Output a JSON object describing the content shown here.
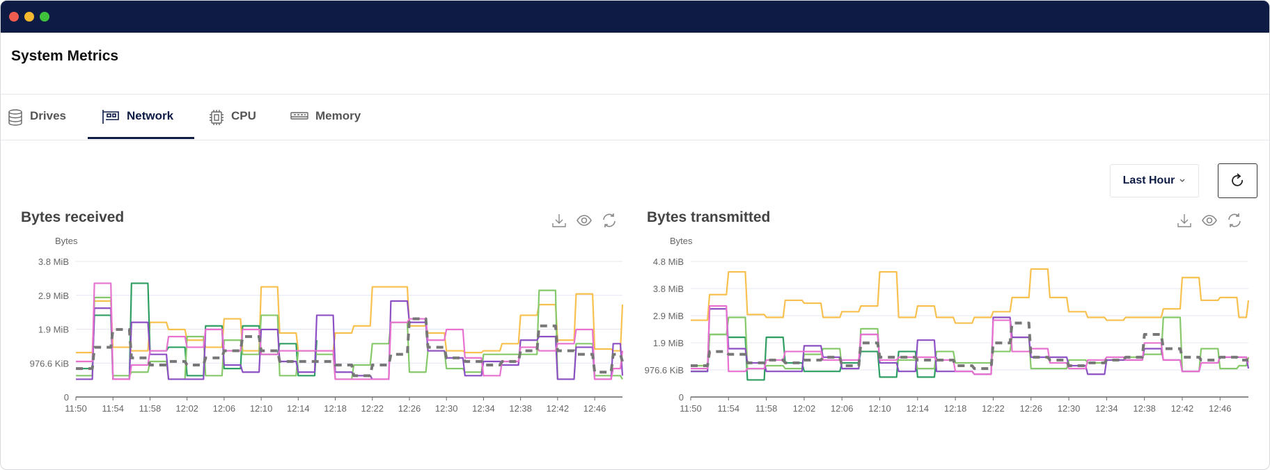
{
  "window": {
    "controls": {
      "close_color": "#ee5d50",
      "minimize_color": "#f5b82e",
      "maximize_color": "#3fc33d"
    }
  },
  "header": {
    "title": "System Metrics"
  },
  "tabs": [
    {
      "label": "Drives",
      "icon": "database-icon",
      "active": false
    },
    {
      "label": "Network",
      "icon": "network-card-icon",
      "active": true
    },
    {
      "label": "CPU",
      "icon": "cpu-chip-icon",
      "active": false
    },
    {
      "label": "Memory",
      "icon": "memory-module-icon",
      "active": false
    }
  ],
  "toolbar": {
    "time_range": "Last Hour",
    "refresh_icon": "refresh-icon"
  },
  "colors": {
    "yellow": "#f8c04e",
    "dark_green": "#2f9e62",
    "light_green": "#86c96b",
    "purple": "#8d4fc4",
    "pink": "#e772cf",
    "average": "#777777",
    "accent": "#0d1b45"
  },
  "chart_data": [
    {
      "type": "line",
      "title": "Bytes received",
      "ylabel": "Bytes",
      "x": [
        "11:50",
        "11:52",
        "11:54",
        "11:56",
        "11:58",
        "12:00",
        "12:02",
        "12:04",
        "12:06",
        "12:08",
        "12:10",
        "12:12",
        "12:14",
        "12:16",
        "12:18",
        "12:20",
        "12:22",
        "12:24",
        "12:26",
        "12:28",
        "12:30",
        "12:32",
        "12:34",
        "12:36",
        "12:38",
        "12:40",
        "12:42",
        "12:44",
        "12:46",
        "12:48",
        "12:49"
      ],
      "x_ticks": [
        "11:50",
        "11:54",
        "11:58",
        "12:02",
        "12:06",
        "12:10",
        "12:14",
        "12:18",
        "12:22",
        "12:26",
        "12:30",
        "12:34",
        "12:38",
        "12:42",
        "12:46"
      ],
      "y_unit": "MiB",
      "y_ticks": [
        {
          "value": 0,
          "label": "0"
        },
        {
          "value": 0.9537,
          "label": "976.6 KiB"
        },
        {
          "value": 1.907,
          "label": "1.9 MiB"
        },
        {
          "value": 2.861,
          "label": "2.9 MiB"
        },
        {
          "value": 3.815,
          "label": "3.8 MiB"
        }
      ],
      "ylim": [
        0,
        3.815
      ],
      "grid": true,
      "series": [
        {
          "color": "#f8c04e",
          "values": [
            1.25,
            2.7,
            1.4,
            1.3,
            2.1,
            1.9,
            1.6,
            1.4,
            2.2,
            1.3,
            3.1,
            1.8,
            1.3,
            1.3,
            1.8,
            2.0,
            3.1,
            3.1,
            2.0,
            1.8,
            1.3,
            1.25,
            1.3,
            1.5,
            2.3,
            2.6,
            1.6,
            2.9,
            1.35,
            1.3,
            2.6
          ]
        },
        {
          "color": "#2f9e62",
          "values": [
            0.8,
            2.3,
            0.5,
            3.2,
            1.3,
            1.4,
            0.6,
            2.0,
            0.8,
            2.0,
            1.2,
            1.5,
            0.6,
            1.6,
            null,
            null,
            null,
            null,
            null,
            null,
            null,
            null,
            null,
            null,
            null,
            null,
            null,
            null,
            null,
            null,
            null
          ]
        },
        {
          "color": "#86c96b",
          "values": [
            0.6,
            2.8,
            0.6,
            0.7,
            1.0,
            0.5,
            1.7,
            0.6,
            1.6,
            1.2,
            2.3,
            0.6,
            1.3,
            1.2,
            0.5,
            0.9,
            1.5,
            2.1,
            0.7,
            1.3,
            0.8,
            0.7,
            1.2,
            1.2,
            1.2,
            3.0,
            0.5,
            1.5,
            0.6,
            0.6,
            0.5
          ]
        },
        {
          "color": "#8d4fc4",
          "values": [
            0.5,
            2.5,
            0.5,
            2.1,
            1.2,
            0.5,
            0.5,
            1.9,
            0.9,
            0.7,
            1.9,
            1.0,
            0.7,
            2.3,
            0.7,
            0.6,
            0.5,
            2.7,
            2.1,
            1.3,
            1.1,
            0.6,
            1.0,
            0.9,
            1.6,
            1.7,
            0.5,
            1.4,
            0.5,
            1.5,
            0.6
          ]
        },
        {
          "color": "#e772cf",
          "values": [
            1.0,
            3.2,
            0.5,
            0.9,
            1.3,
            1.7,
            1.4,
            1.9,
            1.3,
            1.9,
            1.2,
            1.3,
            1.3,
            1.3,
            0.5,
            0.5,
            0.5,
            2.1,
            2.2,
            1.6,
            1.9,
            1.1,
            0.6,
            1.0,
            1.4,
            1.3,
            1.5,
            1.9,
            0.5,
            0.8,
            1.3
          ]
        },
        {
          "color": "#777777",
          "dashed": true,
          "values": [
            0.8,
            1.4,
            1.9,
            1.1,
            0.9,
            1.0,
            0.9,
            1.1,
            1.3,
            1.7,
            1.3,
            1.0,
            1.0,
            1.0,
            0.9,
            0.6,
            0.9,
            1.2,
            2.2,
            1.4,
            1.1,
            1.0,
            0.9,
            1.0,
            1.3,
            2.0,
            1.3,
            1.2,
            0.7,
            1.2,
            1.0
          ]
        }
      ]
    },
    {
      "type": "line",
      "title": "Bytes transmitted",
      "ylabel": "Bytes",
      "x": [
        "11:50",
        "11:52",
        "11:54",
        "11:56",
        "11:58",
        "12:00",
        "12:02",
        "12:04",
        "12:06",
        "12:08",
        "12:10",
        "12:12",
        "12:14",
        "12:16",
        "12:18",
        "12:20",
        "12:22",
        "12:24",
        "12:26",
        "12:28",
        "12:30",
        "12:32",
        "12:34",
        "12:36",
        "12:38",
        "12:40",
        "12:42",
        "12:44",
        "12:46",
        "12:48",
        "12:49"
      ],
      "x_ticks": [
        "11:50",
        "11:54",
        "11:58",
        "12:02",
        "12:06",
        "12:10",
        "12:14",
        "12:18",
        "12:22",
        "12:26",
        "12:30",
        "12:34",
        "12:38",
        "12:42",
        "12:46"
      ],
      "y_unit": "MiB",
      "y_ticks": [
        {
          "value": 0,
          "label": "0"
        },
        {
          "value": 0.9537,
          "label": "976.6 KiB"
        },
        {
          "value": 1.907,
          "label": "1.9 MiB"
        },
        {
          "value": 2.861,
          "label": "2.9 MiB"
        },
        {
          "value": 3.815,
          "label": "3.8 MiB"
        },
        {
          "value": 4.768,
          "label": "4.8 MiB"
        }
      ],
      "ylim": [
        0,
        4.768
      ],
      "grid": true,
      "series": [
        {
          "color": "#f8c04e",
          "values": [
            2.7,
            3.6,
            4.4,
            2.9,
            2.8,
            3.4,
            3.3,
            2.8,
            3.0,
            3.2,
            4.4,
            2.8,
            3.2,
            2.8,
            2.6,
            2.8,
            3.0,
            3.5,
            4.5,
            3.5,
            3.0,
            2.8,
            2.7,
            2.8,
            2.8,
            3.1,
            4.2,
            3.4,
            3.5,
            2.8,
            3.4
          ]
        },
        {
          "color": "#2f9e62",
          "values": [
            0.9,
            2.2,
            2.1,
            0.6,
            2.1,
            1.2,
            0.9,
            0.9,
            1.2,
            1.6,
            0.7,
            1.6,
            0.7,
            1.4,
            null,
            null,
            null,
            null,
            null,
            null,
            null,
            null,
            null,
            null,
            null,
            null,
            null,
            null,
            null,
            null,
            null
          ]
        },
        {
          "color": "#86c96b",
          "values": [
            1.1,
            2.2,
            2.8,
            1.0,
            1.1,
            1.0,
            1.5,
            1.7,
            1.0,
            2.4,
            1.2,
            1.3,
            1.0,
            1.6,
            1.2,
            1.2,
            1.6,
            2.1,
            1.0,
            1.0,
            1.3,
            1.2,
            1.3,
            1.4,
            1.5,
            2.8,
            0.9,
            1.7,
            1.0,
            1.1,
            1.4
          ]
        },
        {
          "color": "#8d4fc4",
          "values": [
            0.9,
            3.1,
            1.7,
            1.2,
            0.9,
            0.9,
            1.8,
            1.4,
            1.0,
            2.2,
            1.2,
            0.9,
            2.0,
            0.9,
            0.9,
            0.8,
            2.8,
            2.1,
            1.4,
            1.4,
            1.1,
            0.8,
            1.3,
            1.3,
            1.7,
            1.3,
            0.9,
            1.2,
            1.4,
            1.4,
            1.0
          ]
        },
        {
          "color": "#e772cf",
          "values": [
            1.0,
            3.2,
            0.9,
            1.0,
            1.3,
            1.6,
            1.6,
            1.3,
            1.3,
            2.2,
            1.3,
            1.4,
            1.4,
            1.3,
            0.9,
            0.8,
            2.7,
            1.6,
            1.7,
            1.2,
            1.0,
            1.3,
            1.4,
            1.3,
            1.9,
            1.3,
            0.9,
            1.2,
            1.4,
            1.4,
            1.2
          ]
        },
        {
          "color": "#777777",
          "dashed": true,
          "values": [
            1.1,
            1.6,
            1.5,
            1.2,
            1.3,
            1.2,
            1.3,
            1.4,
            1.1,
            1.9,
            1.4,
            1.4,
            1.3,
            1.3,
            1.1,
            1.0,
            1.9,
            2.6,
            1.4,
            1.3,
            1.1,
            1.2,
            1.3,
            1.4,
            2.2,
            1.7,
            1.4,
            1.3,
            1.4,
            1.3,
            1.3
          ]
        }
      ]
    }
  ]
}
